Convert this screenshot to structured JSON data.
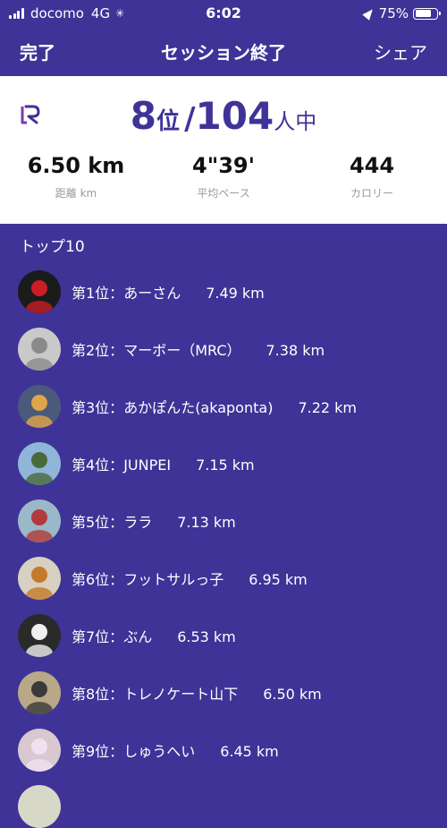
{
  "status_bar": {
    "carrier": "docomo",
    "network": "4G",
    "time": "6:02",
    "battery_text": "75%",
    "battery_level": 0.75
  },
  "nav": {
    "left_label": "完了",
    "title": "セッション終了",
    "right_label": "シェア"
  },
  "summary": {
    "rank": "8",
    "rank_unit": "位",
    "separator": "/",
    "total": "104",
    "total_unit": "人中",
    "stats": [
      {
        "value": "6.50 km",
        "label": "距離 km"
      },
      {
        "value": "4\"39'",
        "label": "平均ペース"
      },
      {
        "value": "444",
        "label": "カロリー"
      }
    ]
  },
  "top10": {
    "title": "トップ10",
    "items": [
      {
        "rank": "第1位：",
        "name": "あーさん",
        "distance": "7.49 km",
        "avatar_bg": "#1b1b1b",
        "avatar_accent": "#c81e24"
      },
      {
        "rank": "第2位：",
        "name": "マーボー（MRC）",
        "distance": "7.38 km",
        "avatar_bg": "#c9c9c9",
        "avatar_accent": "#8a8a8a"
      },
      {
        "rank": "第3位：",
        "name": "あかぽんた(akaponta)",
        "distance": "7.22 km",
        "avatar_bg": "#4a5a7a",
        "avatar_accent": "#e0a44a"
      },
      {
        "rank": "第4位：",
        "name": "JUNPEI",
        "distance": "7.15 km",
        "avatar_bg": "#8fb6d8",
        "avatar_accent": "#4a6a3a"
      },
      {
        "rank": "第5位：",
        "name": "ララ",
        "distance": "7.13 km",
        "avatar_bg": "#9ab8c8",
        "avatar_accent": "#b23a3a"
      },
      {
        "rank": "第6位：",
        "name": "フットサルっ子",
        "distance": "6.95 km",
        "avatar_bg": "#d8d0c0",
        "avatar_accent": "#c47a2a"
      },
      {
        "rank": "第7位：",
        "name": "ぶん",
        "distance": "6.53 km",
        "avatar_bg": "#2a2a2a",
        "avatar_accent": "#f0f0f0"
      },
      {
        "rank": "第8位：",
        "name": "トレノケート山下",
        "distance": "6.50 km",
        "avatar_bg": "#b8a888",
        "avatar_accent": "#3a3a3a"
      },
      {
        "rank": "第9位：",
        "name": "しゅうへい",
        "distance": "6.45 km",
        "avatar_bg": "#d8c8d0",
        "avatar_accent": "#f2e0f0"
      }
    ]
  },
  "colors": {
    "background": "#3f3397",
    "accent": "#3f3397",
    "card": "#ffffff"
  }
}
